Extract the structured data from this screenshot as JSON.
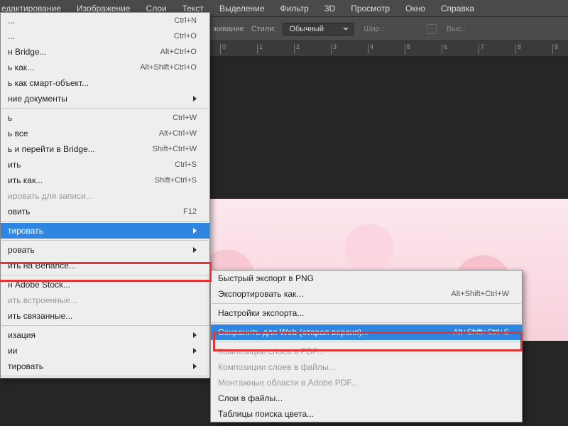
{
  "menubar": [
    "едактирование",
    "Изображение",
    "Слои",
    "Текст",
    "Выделение",
    "Фильтр",
    "3D",
    "Просмотр",
    "Окно",
    "Справка"
  ],
  "options": {
    "transform": "живание",
    "styles": "Стили:",
    "style_val": "Обычный",
    "width": "Шир.:",
    "swap": "⇄",
    "height": "Выс.:"
  },
  "ruler_ticks": [
    {
      "pos": 310,
      "n": "0"
    },
    {
      "pos": 362,
      "n": "1"
    },
    {
      "pos": 414,
      "n": "2"
    },
    {
      "pos": 466,
      "n": "3"
    },
    {
      "pos": 518,
      "n": "4"
    },
    {
      "pos": 570,
      "n": "5"
    },
    {
      "pos": 622,
      "n": "6"
    },
    {
      "pos": 674,
      "n": "7"
    },
    {
      "pos": 726,
      "n": "8"
    },
    {
      "pos": 778,
      "n": "9"
    }
  ],
  "col1": [
    {
      "t": "...",
      "sc": "Ctrl+N"
    },
    {
      "t": "...",
      "sc": "Ctrl+O"
    },
    {
      "t": "н Bridge...",
      "sc": "Alt+Ctrl+O"
    },
    {
      "t": "ь как...",
      "sc": "Alt+Shift+Ctrl+O"
    },
    {
      "t": "ь как смарт-объект..."
    },
    {
      "t": "ние документы",
      "arrow": true
    },
    {
      "sep": true
    },
    {
      "t": "ь",
      "sc": "Ctrl+W"
    },
    {
      "t": "ь все",
      "sc": "Alt+Ctrl+W"
    },
    {
      "t": "ь и перейти в Bridge...",
      "sc": "Shift+Ctrl+W"
    },
    {
      "t": "ить",
      "sc": "Ctrl+S"
    },
    {
      "t": "ить как...",
      "sc": "Shift+Ctrl+S"
    },
    {
      "t": "ировать для записи...",
      "dis": true
    },
    {
      "t": "овить",
      "sc": "F12"
    },
    {
      "sep": true
    },
    {
      "t": "тировать",
      "arrow": true,
      "hl": true,
      "id": "export"
    },
    {
      "sep": true
    },
    {
      "t": "ровать",
      "arrow": true
    },
    {
      "t": "ить на Behance..."
    },
    {
      "sep": true
    },
    {
      "t": "н Adobe Stock..."
    },
    {
      "t": "ить встроенные...",
      "dis": true
    },
    {
      "t": "ить связанные..."
    },
    {
      "sep": true
    },
    {
      "t": "изация",
      "arrow": true
    },
    {
      "t": "ии",
      "arrow": true
    },
    {
      "t": "тировать",
      "arrow": true
    },
    {
      "sep": true
    }
  ],
  "col2": [
    {
      "t": "Быстрый экспорт в PNG"
    },
    {
      "t": "Экспортировать как...",
      "sc": "Alt+Shift+Ctrl+W"
    },
    {
      "sep": true
    },
    {
      "t": "Настройки экспорта..."
    },
    {
      "sep": true
    },
    {
      "t": "Сохранить для Web (старая версия)...",
      "sc": "Alt+Shift+Ctrl+S",
      "hl": true,
      "id": "save-web"
    },
    {
      "sep": true
    },
    {
      "t": "Композиции слоев в PDF...",
      "dis": true
    },
    {
      "t": "Композиции слоев в файлы...",
      "dis": true
    },
    {
      "t": "Монтажные области в Adobe PDF...",
      "dis": true
    },
    {
      "t": "Слои в файлы..."
    },
    {
      "t": "Таблицы поиска цвета..."
    }
  ]
}
